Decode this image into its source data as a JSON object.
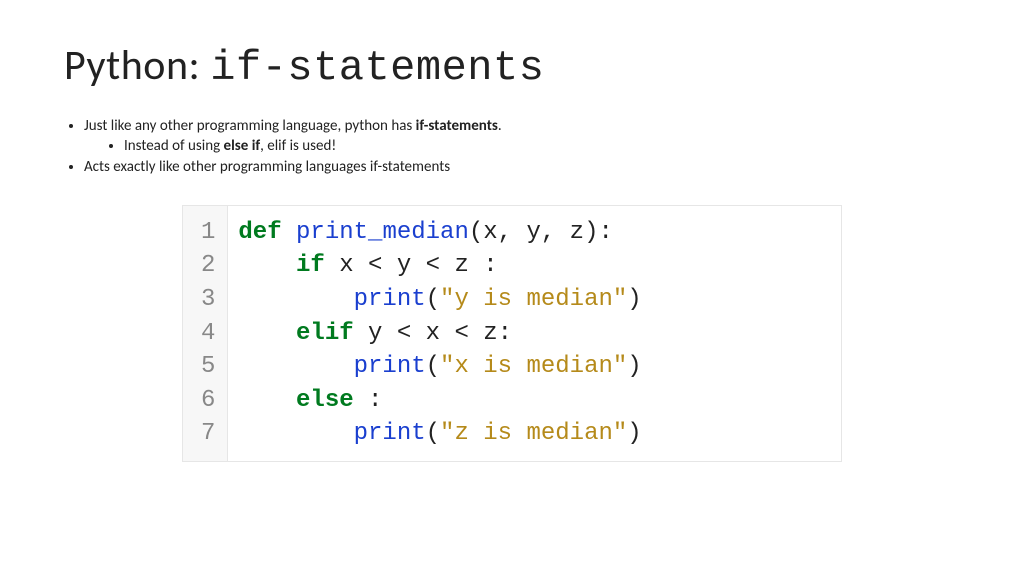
{
  "title_prefix": "Python: ",
  "title_mono": "if-statements",
  "bullets": {
    "b1_pre": "Just like any other programming language, python has ",
    "b1_bold": "if-statements",
    "b1_post": ".",
    "b1a_pre": "Instead of using ",
    "b1a_bold": "else if",
    "b1a_post": ", elif is used!",
    "b2": "Acts exactly like other programming languages if-statements"
  },
  "line_numbers": [
    "1",
    "2",
    "3",
    "4",
    "5",
    "6",
    "7"
  ],
  "code": {
    "kw_def": "def",
    "fn_name": "print_median",
    "params_open": "(x, y, z):",
    "kw_if": "if",
    "cond1": " x < y < z :",
    "fn_print": "print",
    "pr_open": "(",
    "pr_close": ")",
    "str_y": "\"y is median\"",
    "kw_elif": "elif",
    "cond2": " y < x < z:",
    "str_x": "\"x is median\"",
    "kw_else": "else",
    "else_post": " :",
    "str_z": "\"z is median\""
  }
}
